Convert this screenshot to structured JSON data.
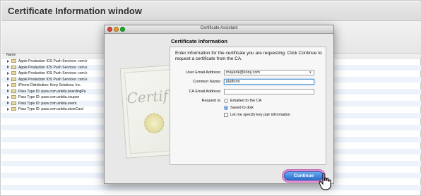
{
  "banner": {
    "title": "Certificate Information window"
  },
  "keychain": {
    "column_header": "Name",
    "rows": [
      "Apple Production IOS Push Services: com.k",
      "Apple Production IOS Push Services: com.k",
      "Apple Production IOS Push Services: com.k",
      "Apple Production IOS Push Services: com.k",
      "iPhone Distribution: Kony Solutions, Inc.",
      "Pass Type ID: pass.com.ankita.boardingPa",
      "Pass Type ID: pass.com.ankita.coupon",
      "Pass Type ID: pass.com.ankita.event",
      "Pass Type ID: pass.com.ankita.storeCard"
    ]
  },
  "dialog": {
    "title": "Certificate Assistant",
    "art_text": "Certif",
    "section_title": "Certificate Information",
    "instruction": "Enter information for the certificate you are requesting. Click Continue to request a certificate from the CA.",
    "email_label": "User Email Address:",
    "email_value": "mayank@kony.com",
    "common_name_label": "Common Name:",
    "common_name_value": "platform",
    "ca_email_label": "CA Email Address:",
    "ca_email_value": "",
    "request_label": "Request is:",
    "option_emailed": "Emailed to the CA",
    "option_saved": "Saved to disk",
    "option_keypair": "Let me specify key pair information",
    "selected_option": "Saved to disk",
    "continue_label": "Continue"
  },
  "colors": {
    "accent": "#2a6fce",
    "highlight_ring": "#e08ad2"
  }
}
